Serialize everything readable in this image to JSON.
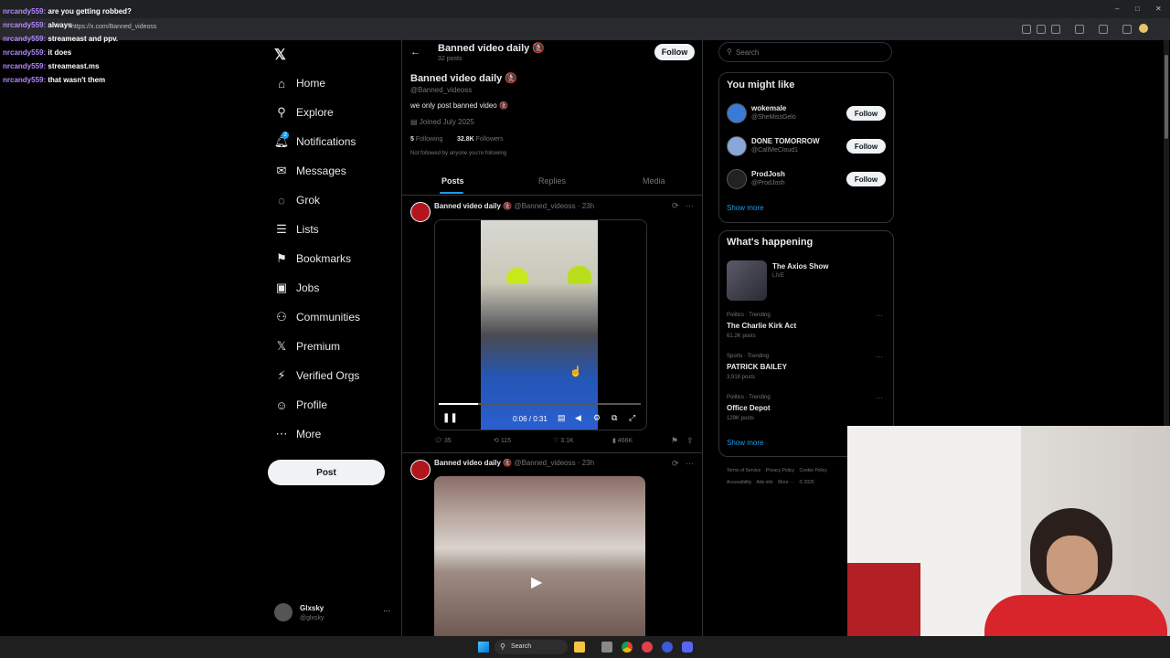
{
  "browser": {
    "url": "https://x.com/Banned_videoss",
    "win_controls": [
      "–",
      "□",
      "✕"
    ]
  },
  "chat": [
    {
      "user": "nrcandy559:",
      "msg": "are you getting robbed?"
    },
    {
      "user": "nrcandy559:",
      "msg": "always"
    },
    {
      "user": "nrcandy559:",
      "msg": "streameast and ppv."
    },
    {
      "user": "nrcandy559:",
      "msg": "it does"
    },
    {
      "user": "nrcandy559:",
      "msg": "streameast.ms"
    },
    {
      "user": "nrcandy559:",
      "msg": "that wasn't them"
    }
  ],
  "nav": {
    "logo": "𝕏",
    "items": [
      {
        "label": "Home",
        "icon": "home-icon",
        "glyph": "⌂"
      },
      {
        "label": "Explore",
        "icon": "search-icon",
        "glyph": "⚲"
      },
      {
        "label": "Notifications",
        "icon": "bell-icon",
        "glyph": "🔔︎"
      },
      {
        "label": "Messages",
        "icon": "mail-icon",
        "glyph": "✉"
      },
      {
        "label": "Grok",
        "icon": "grok-icon",
        "glyph": "◌"
      },
      {
        "label": "Lists",
        "icon": "list-icon",
        "glyph": "☰"
      },
      {
        "label": "Bookmarks",
        "icon": "bookmark-icon",
        "glyph": "⚑"
      },
      {
        "label": "Jobs",
        "icon": "briefcase-icon",
        "glyph": "▣"
      },
      {
        "label": "Communities",
        "icon": "people-icon",
        "glyph": "⚇"
      },
      {
        "label": "Premium",
        "icon": "x-logo-icon",
        "glyph": "𝕏"
      },
      {
        "label": "Verified Orgs",
        "icon": "lightning-icon",
        "glyph": "⚡︎"
      },
      {
        "label": "Profile",
        "icon": "person-icon",
        "glyph": "☺"
      },
      {
        "label": "More",
        "icon": "more-circle-icon",
        "glyph": "⋯"
      }
    ],
    "notification_badge": "2",
    "post_label": "Post",
    "account": {
      "name": "Glxsky",
      "handle": "@glxsky",
      "more": "···"
    }
  },
  "profile": {
    "header_name": "Banned video daily",
    "header_posts": "32 posts",
    "name": "Banned video daily",
    "emoji": "🚷",
    "handle": "@Banned_videoss",
    "bio": "we only post banned video",
    "joined": "Joined July 2025",
    "following_count": "5",
    "following_label": "Following",
    "followers_count": "32.8K",
    "followers_label": "Followers",
    "not_followed": "Not followed by anyone you're following",
    "follow_label": "Follow",
    "tabs": [
      "Posts",
      "Replies",
      "Media"
    ]
  },
  "posts": [
    {
      "name": "Banned video daily",
      "handle": "@Banned_videoss",
      "time": "23h",
      "video_time": "0:06 / 0:31",
      "replies": "35",
      "reposts": "115",
      "likes": "3.1K",
      "views": "466K"
    },
    {
      "name": "Banned video daily",
      "handle": "@Banned_videoss",
      "time": "23h"
    }
  ],
  "right": {
    "search_placeholder": "Search",
    "might_like_title": "You might like",
    "suggestions": [
      {
        "name": "wokemale",
        "handle": "@SheMissGelo",
        "follow": "Follow"
      },
      {
        "name": "DONE TOMORROW",
        "handle": "@CallMeCloud1",
        "follow": "Follow"
      },
      {
        "name": "ProdJosh",
        "handle": "@ProdJosh",
        "follow": "Follow"
      }
    ],
    "show_more": "Show more",
    "happening_title": "What's happening",
    "live": {
      "title": "The Axios Show",
      "status": "LIVE"
    },
    "trends": [
      {
        "context": "Politics · Trending",
        "topic": "The Charlie Kirk Act",
        "count": "61.2K posts"
      },
      {
        "context": "Sports · Trending",
        "topic": "PATRICK BAILEY",
        "count": "3,918 posts"
      },
      {
        "context": "Politics · Trending",
        "topic": "Office Depot",
        "count": "129K posts"
      }
    ],
    "show_more_2": "Show more",
    "footer": [
      "Terms of Service",
      "Privacy Policy",
      "Cookie Policy",
      "Accessibility",
      "Ads info",
      "More ···",
      "© 2025"
    ]
  },
  "taskbar": {
    "search": "Search"
  },
  "colors": {
    "accent": "#1d9bf0",
    "bg": "#000000",
    "border": "#2f3336",
    "chat_user": "#b387ff"
  }
}
